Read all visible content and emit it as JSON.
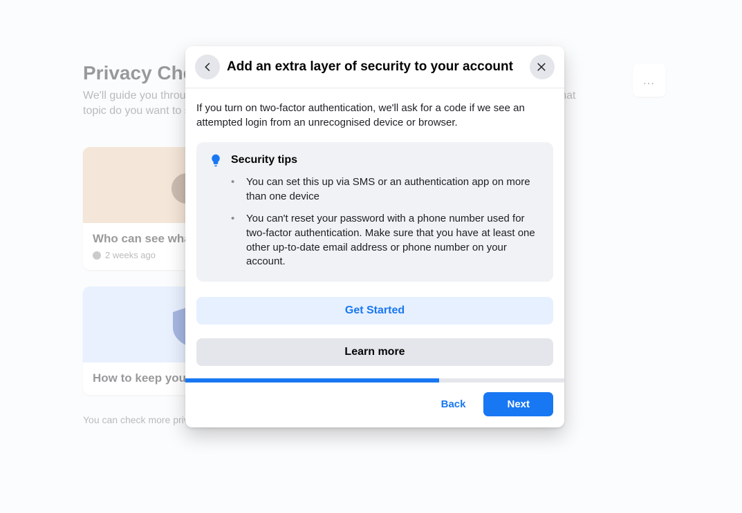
{
  "background": {
    "title": "Privacy Checkup",
    "description": "We'll guide you through some settings so that you can make the right choices for your account. What topic do you want to start with?",
    "cards": [
      {
        "title": "Who can see what you share",
        "meta": "2 weeks ago"
      },
      {
        "title": "How to keep your account secure",
        "meta": ""
      }
    ],
    "footer": "You can check more privacy settings on Facebook in settings.",
    "overflow_label": "…"
  },
  "modal": {
    "title": "Add an extra layer of security to your account",
    "intro": "If you turn on two-factor authentication, we'll ask for a code if we see an attempted login from an unrecognised device or browser.",
    "tips_title": "Security tips",
    "tips": [
      "You can set this up via SMS or an authentication app on more than one device",
      "You can't reset your password with a phone number used for two-factor authentication. Make sure that you have at least one other up-to-date email address or phone number on your account."
    ],
    "get_started_label": "Get Started",
    "learn_more_label": "Learn more",
    "back_label": "Back",
    "next_label": "Next",
    "progress_percent": 67
  }
}
